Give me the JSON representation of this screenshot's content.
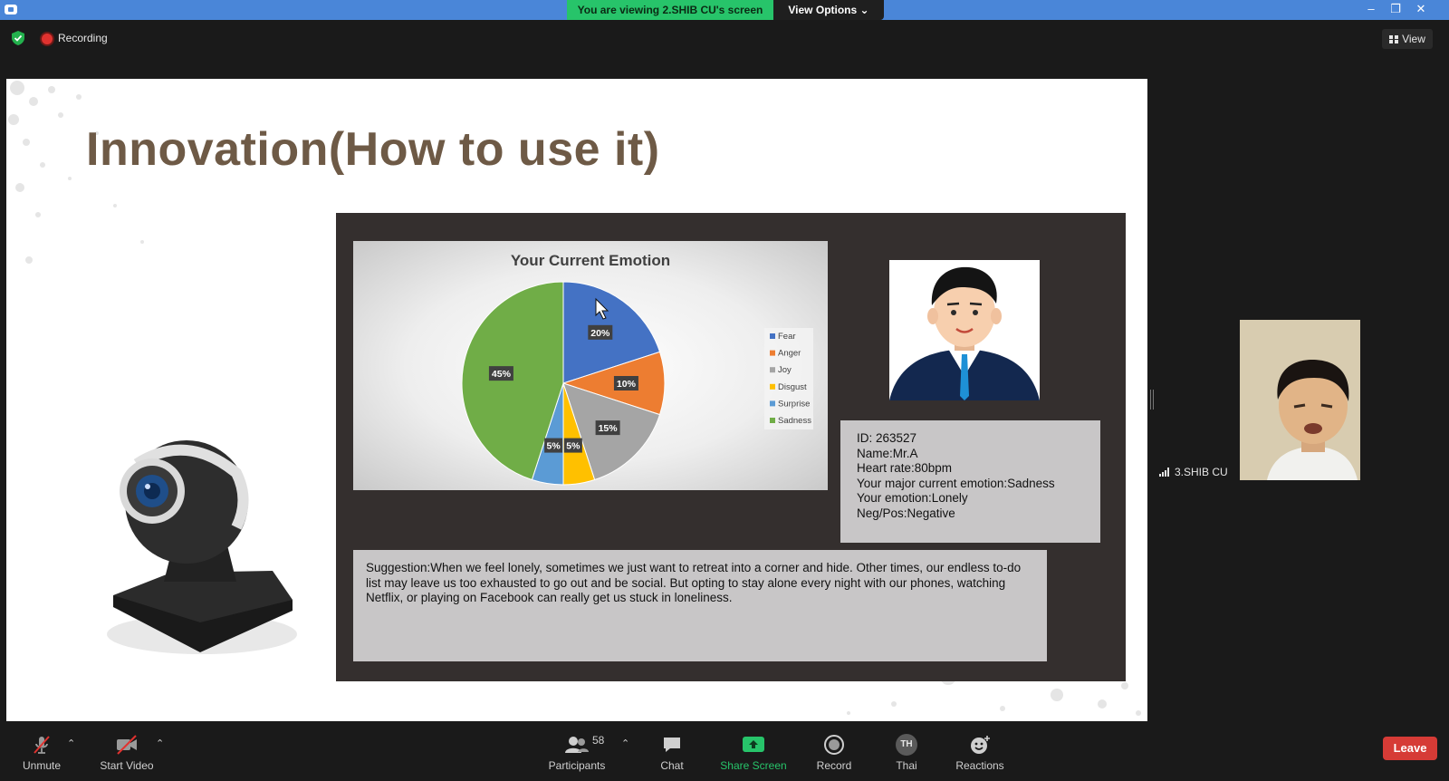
{
  "window": {
    "viewing_banner": "You are viewing 2.SHIB CU's screen",
    "view_options": "View Options",
    "minimize_icon": "minimize-icon",
    "restore_icon": "restore-icon",
    "close_icon": "close-icon"
  },
  "topbar": {
    "recording_label": "Recording",
    "view_label": "View"
  },
  "slide": {
    "title": "Innovation(How to use it)",
    "info": {
      "id": "ID: 263527",
      "name": "Name:Mr.A",
      "heart_rate": "Heart rate:80bpm",
      "major_emotion": "Your major current emotion:Sadness",
      "emotion": "Your emotion:Lonely",
      "neg_pos": "Neg/Pos:Negative"
    },
    "suggestion": "Suggestion:When we feel lonely, sometimes we just want to retreat into a corner and hide. Other times, our endless to-do list may leave us too exhausted to go out and be social. But opting to stay alone every night with our phones, watching Netflix, or playing on Facebook can really get us stuck in loneliness."
  },
  "chart_data": {
    "type": "pie",
    "title": "Your Current Emotion",
    "categories": [
      "Fear",
      "Anger",
      "Joy",
      "Disgust",
      "Surprise",
      "Sadness"
    ],
    "values": [
      20,
      10,
      15,
      5,
      5,
      45
    ],
    "data_labels": [
      "20%",
      "10%",
      "15%",
      "5%",
      "5%",
      "45%"
    ],
    "colors": [
      "#4472c4",
      "#ed7d31",
      "#a5a5a5",
      "#ffc000",
      "#5b9bd5",
      "#70ad47"
    ],
    "legend_position": "right"
  },
  "participant": {
    "name": "3.SHIB CU"
  },
  "toolbar": {
    "unmute": "Unmute",
    "start_video": "Start Video",
    "participants": "Participants",
    "participants_count": "58",
    "chat": "Chat",
    "share_screen": "Share Screen",
    "record": "Record",
    "avatar_initials": "TH",
    "thai": "Thai",
    "reactions": "Reactions",
    "leave": "Leave",
    "colors": {
      "share": "#27c46a",
      "leave": "#d63b36"
    }
  }
}
